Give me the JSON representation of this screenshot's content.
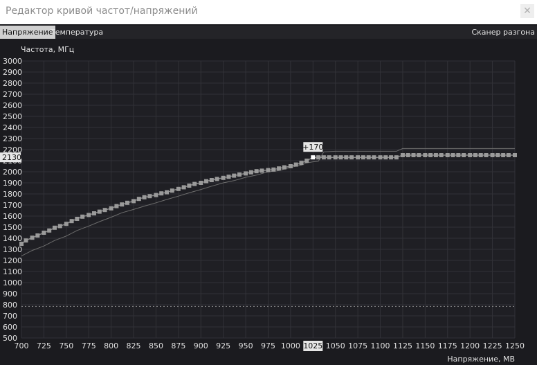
{
  "window": {
    "title": "Редактор кривой частот/напряжений",
    "close_label": "✕"
  },
  "tabs": [
    {
      "label": "Напряжение",
      "active": true
    },
    {
      "label": "Температура",
      "active": false
    }
  ],
  "scanner_label": "Сканер разгона",
  "colors": {
    "background": "#1b1b1f",
    "grid": "#323238",
    "curve": "#8a8a8a",
    "default_curve": "#6e6e6e",
    "active_point": "#ffffff"
  },
  "chart_data": {
    "type": "line",
    "ylabel": "Частота, МГц",
    "xlabel": "Напряжение, МВ",
    "xlim": [
      700,
      1250
    ],
    "ylim": [
      500,
      3000
    ],
    "x_ticks": [
      700,
      725,
      750,
      775,
      800,
      825,
      850,
      875,
      900,
      925,
      950,
      975,
      1000,
      1025,
      1050,
      1075,
      1100,
      1125,
      1150,
      1175,
      1200,
      1225,
      1250
    ],
    "y_ticks": [
      500,
      600,
      700,
      800,
      900,
      1000,
      1100,
      1200,
      1300,
      1400,
      1500,
      1600,
      1700,
      1800,
      1900,
      2000,
      2100,
      2200,
      2300,
      2400,
      2500,
      2600,
      2700,
      2800,
      2900,
      3000
    ],
    "grid": true,
    "reference_line": 785,
    "highlight_x": 1025,
    "highlight_y": 2130,
    "offset_label": "+170",
    "series": [
      {
        "role": "curve",
        "x": [
          700,
          705,
          712,
          718,
          725,
          731,
          737,
          743,
          750,
          756,
          762,
          768,
          775,
          781,
          787,
          793,
          800,
          806,
          812,
          818,
          825,
          831,
          837,
          843,
          850,
          856,
          862,
          868,
          875,
          881,
          887,
          893,
          900,
          906,
          912,
          918,
          925,
          931,
          937,
          943,
          950,
          956,
          962,
          968,
          975,
          981,
          987,
          993,
          1000,
          1006,
          1012,
          1018,
          1025,
          1031,
          1037,
          1043,
          1050,
          1056,
          1062,
          1068,
          1075,
          1081,
          1087,
          1093,
          1100,
          1106,
          1112,
          1118,
          1125,
          1131,
          1137,
          1143,
          1150,
          1156,
          1162,
          1168,
          1175,
          1181,
          1187,
          1193,
          1200,
          1206,
          1212,
          1218,
          1225,
          1231,
          1237,
          1243,
          1250
        ],
        "values": [
          1350,
          1380,
          1405,
          1425,
          1450,
          1470,
          1495,
          1510,
          1530,
          1555,
          1575,
          1595,
          1610,
          1625,
          1640,
          1655,
          1670,
          1690,
          1705,
          1720,
          1735,
          1755,
          1770,
          1780,
          1790,
          1805,
          1815,
          1830,
          1845,
          1860,
          1875,
          1890,
          1900,
          1915,
          1925,
          1935,
          1945,
          1955,
          1965,
          1975,
          1985,
          1995,
          2005,
          2010,
          2015,
          2020,
          2030,
          2040,
          2050,
          2065,
          2080,
          2100,
          2130,
          2130,
          2130,
          2130,
          2130,
          2130,
          2130,
          2130,
          2130,
          2130,
          2130,
          2130,
          2130,
          2130,
          2130,
          2130,
          2150,
          2150,
          2150,
          2150,
          2150,
          2150,
          2150,
          2150,
          2150,
          2150,
          2150,
          2150,
          2150,
          2150,
          2150,
          2150,
          2150,
          2150,
          2150,
          2150,
          2150
        ]
      },
      {
        "role": "default",
        "x": [
          700,
          712,
          725,
          737,
          750,
          762,
          775,
          787,
          800,
          812,
          825,
          837,
          850,
          862,
          875,
          887,
          900,
          912,
          925,
          937,
          950,
          962,
          975,
          987,
          1000,
          1012,
          1018,
          1025,
          1031,
          1037,
          1050,
          1100,
          1118,
          1125,
          1150,
          1200,
          1250
        ],
        "values": [
          1240,
          1290,
          1330,
          1380,
          1420,
          1470,
          1510,
          1550,
          1590,
          1630,
          1660,
          1690,
          1720,
          1750,
          1780,
          1810,
          1840,
          1870,
          1900,
          1920,
          1950,
          1970,
          2000,
          2010,
          2040,
          2060,
          2080,
          2090,
          2095,
          2180,
          2185,
          2185,
          2185,
          2210,
          2210,
          2210,
          2210
        ]
      }
    ]
  }
}
